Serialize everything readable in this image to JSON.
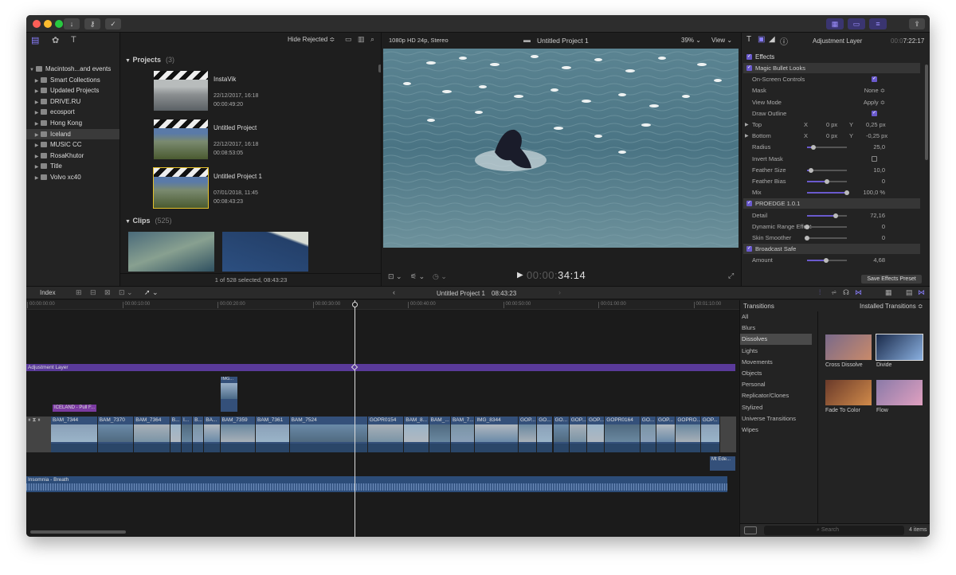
{
  "browser": {
    "filter": "Hide Rejected",
    "status": "1 of 528 selected, 08:43:23"
  },
  "library": [
    {
      "label": "Macintosh...and events",
      "level": 0,
      "open": true
    },
    {
      "label": "Smart Collections",
      "level": 1
    },
    {
      "label": "Updated Projects",
      "level": 1
    },
    {
      "label": "DRIVE.RU",
      "level": 1
    },
    {
      "label": "ecosport",
      "level": 1
    },
    {
      "label": "Hong Kong",
      "level": 1
    },
    {
      "label": "Iceland",
      "level": 1,
      "selected": true
    },
    {
      "label": "MUSIC CC",
      "level": 1
    },
    {
      "label": "RosaKhutor",
      "level": 1
    },
    {
      "label": "Title",
      "level": 1
    },
    {
      "label": "Volvo xc40",
      "level": 1
    }
  ],
  "projects": {
    "label": "Projects",
    "count": "(3)",
    "items": [
      {
        "title": "InstaVik",
        "date": "22/12/2017, 16:18",
        "duration": "00:00:49:20"
      },
      {
        "title": "Untitled Project",
        "date": "22/12/2017, 16:18",
        "duration": "00:08:53:05"
      },
      {
        "title": "Untitled Project 1",
        "date": "07/01/2018, 11:45",
        "duration": "00:08:43:23"
      }
    ]
  },
  "clips": {
    "label": "Clips",
    "count": "(525)"
  },
  "viewer": {
    "format": "1080p HD 24p, Stereo",
    "title": "Untitled Project 1",
    "zoom": "39%",
    "view": "View",
    "timecode_dim": "00:00:",
    "timecode": "34:14"
  },
  "inspector": {
    "title": "Adjustment Layer",
    "timecode_dim": "00:0",
    "timecode": "7:22:17",
    "save_preset": "Save Effects Preset",
    "effects_label": "Effects",
    "rows": [
      {
        "type": "hdr",
        "label": "Magic Bullet Looks",
        "checked": true
      },
      {
        "label": "On-Screen Controls",
        "check": true
      },
      {
        "label": "Mask",
        "value": "None ≎"
      },
      {
        "label": "View Mode",
        "value": "Apply ≎"
      },
      {
        "label": "Draw Outline",
        "check": true
      },
      {
        "label": "Top",
        "tri": true,
        "x": "0 px",
        "y": "0,25 px"
      },
      {
        "label": "Bottom",
        "tri": true,
        "x": "0 px",
        "y": "-0,25 px"
      },
      {
        "label": "Radius",
        "slider": 0.15,
        "value": "25,0"
      },
      {
        "label": "Invert Mask",
        "check": false
      },
      {
        "label": "Feather Size",
        "slider": 0.1,
        "value": "10,0"
      },
      {
        "label": "Feather Bias",
        "slider": 0.5,
        "value": "0"
      },
      {
        "label": "Mix",
        "slider": 1.0,
        "value": "100,0 %"
      },
      {
        "type": "hdr",
        "label": "PROEDGE 1.0.1",
        "checked": true
      },
      {
        "label": "Detail",
        "slider": 0.72,
        "value": "72,16"
      },
      {
        "label": "Dynamic Range Effect",
        "slider": 0.0,
        "value": "0"
      },
      {
        "label": "Skin Smoother",
        "slider": 0.0,
        "value": "0"
      },
      {
        "type": "hdr",
        "label": "Broadcast Safe",
        "checked": true
      },
      {
        "label": "Amount",
        "slider": 0.47,
        "value": "4,68"
      }
    ]
  },
  "timeline": {
    "index": "Index",
    "project": "Untitled Project 1",
    "duration": "08:43:23",
    "ruler": [
      "00:00:00:00",
      "00:00:10:00",
      "00:00:20:00",
      "00:00:30:00",
      "00:00:40:00",
      "00:00:50:00",
      "00:01:00:00",
      "00:01:10:00"
    ],
    "adjustment": "Adjustment Layer",
    "iceland": "ICELAND - Pull F...",
    "img_conn": "IMG...",
    "mt": "Mt Ede...",
    "audio": "Insomnia - Breath",
    "clips": [
      {
        "l": "BAM_7344",
        "w": 58
      },
      {
        "l": "BAM_7370",
        "w": 45
      },
      {
        "l": "BAM_7364",
        "w": 45
      },
      {
        "l": "B...",
        "w": 14
      },
      {
        "l": "I...",
        "w": 14
      },
      {
        "l": "B...",
        "w": 14
      },
      {
        "l": "BA...",
        "w": 20
      },
      {
        "l": "BAM_7359",
        "w": 44
      },
      {
        "l": "BAM_7361",
        "w": 42
      },
      {
        "l": "BAM_7524",
        "w": 97
      },
      {
        "l": "GOPR0154",
        "w": 45
      },
      {
        "l": "BAM_8...",
        "w": 31
      },
      {
        "l": "BAM_...",
        "w": 27
      },
      {
        "l": "BAM_7...",
        "w": 30
      },
      {
        "l": "IMG_8344",
        "w": 54
      },
      {
        "l": "GOP...",
        "w": 23
      },
      {
        "l": "GO...",
        "w": 20
      },
      {
        "l": "GO...",
        "w": 20
      },
      {
        "l": "GOP...",
        "w": 22
      },
      {
        "l": "GOP...",
        "w": 22
      },
      {
        "l": "GOPR0164",
        "w": 44
      },
      {
        "l": "GO...",
        "w": 20
      },
      {
        "l": "GOP...",
        "w": 24
      },
      {
        "l": "GOPRO...",
        "w": 31
      },
      {
        "l": "GOP...",
        "w": 24
      }
    ]
  },
  "transitions": {
    "title": "Transitions",
    "installed": "Installed Transitions ≎",
    "count": "4 items",
    "search": "Search",
    "categories": [
      "All",
      "Blurs",
      "Dissolves",
      "Lights",
      "Movements",
      "Objects",
      "Personal",
      "Replicator/Clones",
      "Stylized",
      "Universe Transitions",
      "Wipes"
    ],
    "selected": "Dissolves",
    "items": [
      {
        "name": "Cross Dissolve",
        "c1": "#7a6a8a",
        "c2": "#c98a6a"
      },
      {
        "name": "Divide",
        "c1": "#1a2a4a",
        "c2": "#8ab0e0"
      },
      {
        "name": "Fade To Color",
        "c1": "#6a3a2a",
        "c2": "#d08a4a"
      },
      {
        "name": "Flow",
        "c1": "#8a7aa8",
        "c2": "#e0a0c0"
      }
    ]
  }
}
